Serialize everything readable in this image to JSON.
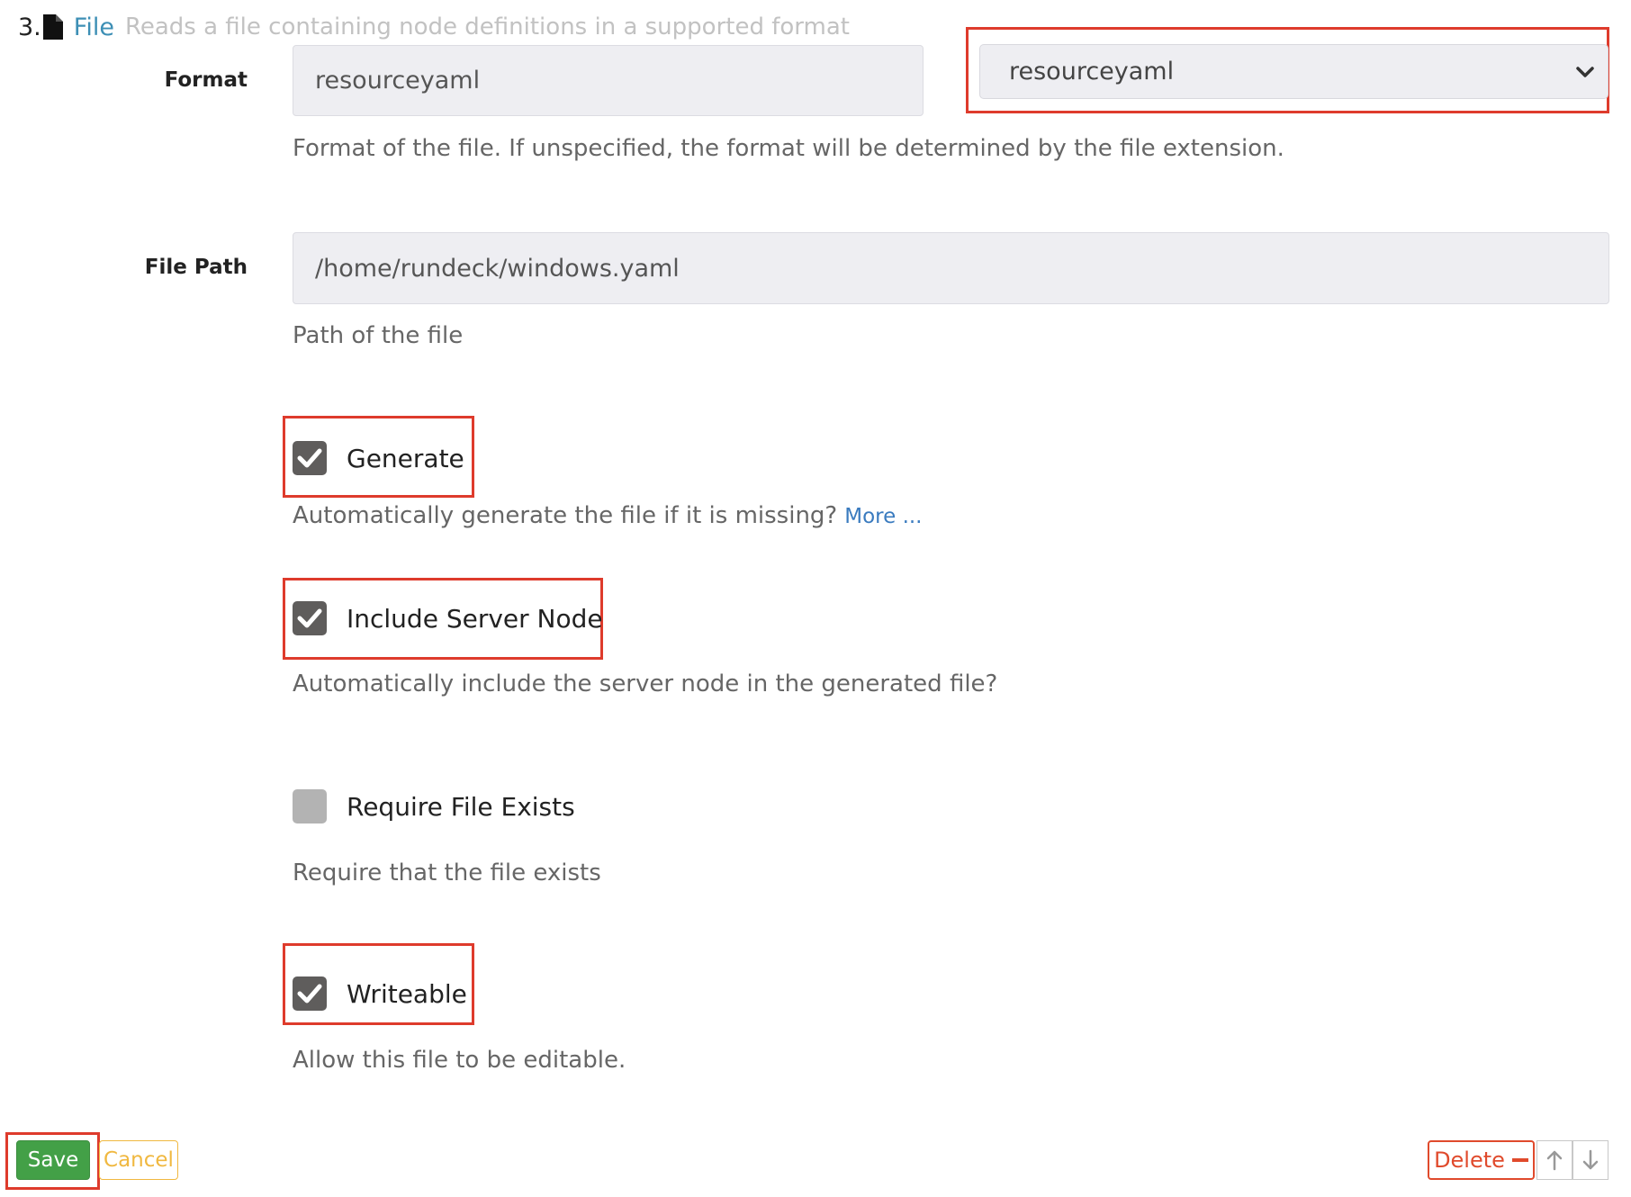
{
  "header": {
    "index": "3.",
    "title": "File",
    "description": "Reads a file containing node definitions in a supported format"
  },
  "format": {
    "label": "Format",
    "value": "resourceyaml",
    "select_value": "resourceyaml",
    "help": "Format of the file. If unspecified, the format will be determined by the file extension."
  },
  "file_path": {
    "label": "File Path",
    "value": "/home/rundeck/windows.yaml",
    "help": "Path of the file"
  },
  "generate": {
    "label": "Generate",
    "checked": true,
    "help": "Automatically generate the file if it is missing?",
    "more": "More ..."
  },
  "include_server_node": {
    "label": "Include Server Node",
    "checked": true,
    "help": "Automatically include the server node in the generated file?"
  },
  "require_file_exists": {
    "label": "Require File Exists",
    "checked": false,
    "help": "Require that the file exists"
  },
  "writeable": {
    "label": "Writeable",
    "checked": true,
    "help": "Allow this file to be editable."
  },
  "actions": {
    "save": "Save",
    "cancel": "Cancel",
    "delete": "Delete"
  },
  "colors": {
    "highlight": "#de3b2c",
    "link": "#3d8fb5",
    "save": "#43a047",
    "cancel": "#f0b840",
    "delete": "#e04a2c"
  },
  "icons": [
    "file-icon",
    "chevron-down-icon",
    "checkmark-icon",
    "minus-icon",
    "arrow-up-icon",
    "arrow-down-icon"
  ]
}
